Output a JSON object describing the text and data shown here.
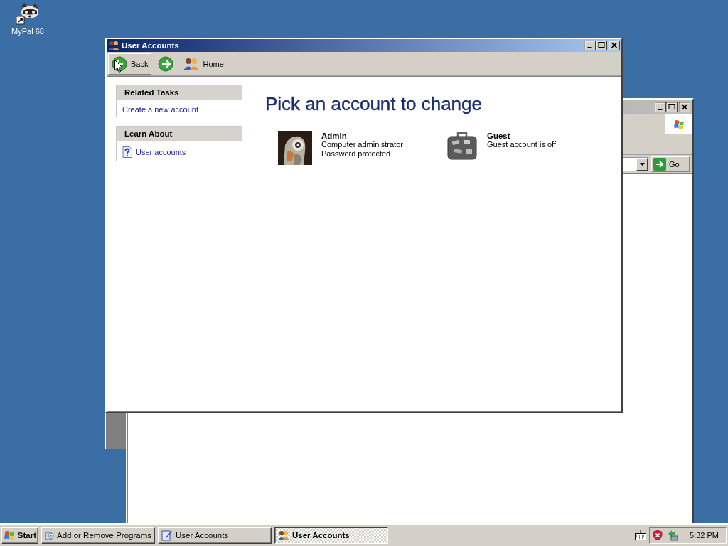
{
  "desktop_icons": [
    {
      "label": "MyPal 68"
    }
  ],
  "back_window": {
    "go_button": "Go"
  },
  "main_window": {
    "title": "User Accounts",
    "toolbar": [
      {
        "kind": "back",
        "label": "Back",
        "hovered": true
      },
      {
        "kind": "forward",
        "hovered": false
      },
      {
        "kind": "home",
        "label": "Home",
        "hovered": false
      }
    ],
    "side_panels": [
      {
        "title": "Related Tasks",
        "links": [
          {
            "kind": "plain",
            "label": "Create a new account"
          }
        ]
      },
      {
        "title": "Learn About",
        "links": [
          {
            "kind": "help",
            "label": "User accounts"
          }
        ]
      }
    ],
    "heading": "Pick an account to change",
    "accounts": [
      {
        "kind": "picture",
        "name": "Admin",
        "details": [
          "Computer administrator",
          "Password protected"
        ]
      },
      {
        "kind": "suitcase",
        "name": "Guest",
        "details": [
          "Guest account is off"
        ]
      }
    ]
  },
  "taskbar": {
    "start": "Start",
    "tasks": [
      {
        "kind": "programs",
        "label": "Add or Remove Programs",
        "selected": false
      },
      {
        "kind": "pen",
        "label": "User Accounts",
        "selected": false
      },
      {
        "kind": "users",
        "label": "User Accounts",
        "selected": true
      }
    ],
    "clock": "5:32 PM"
  }
}
